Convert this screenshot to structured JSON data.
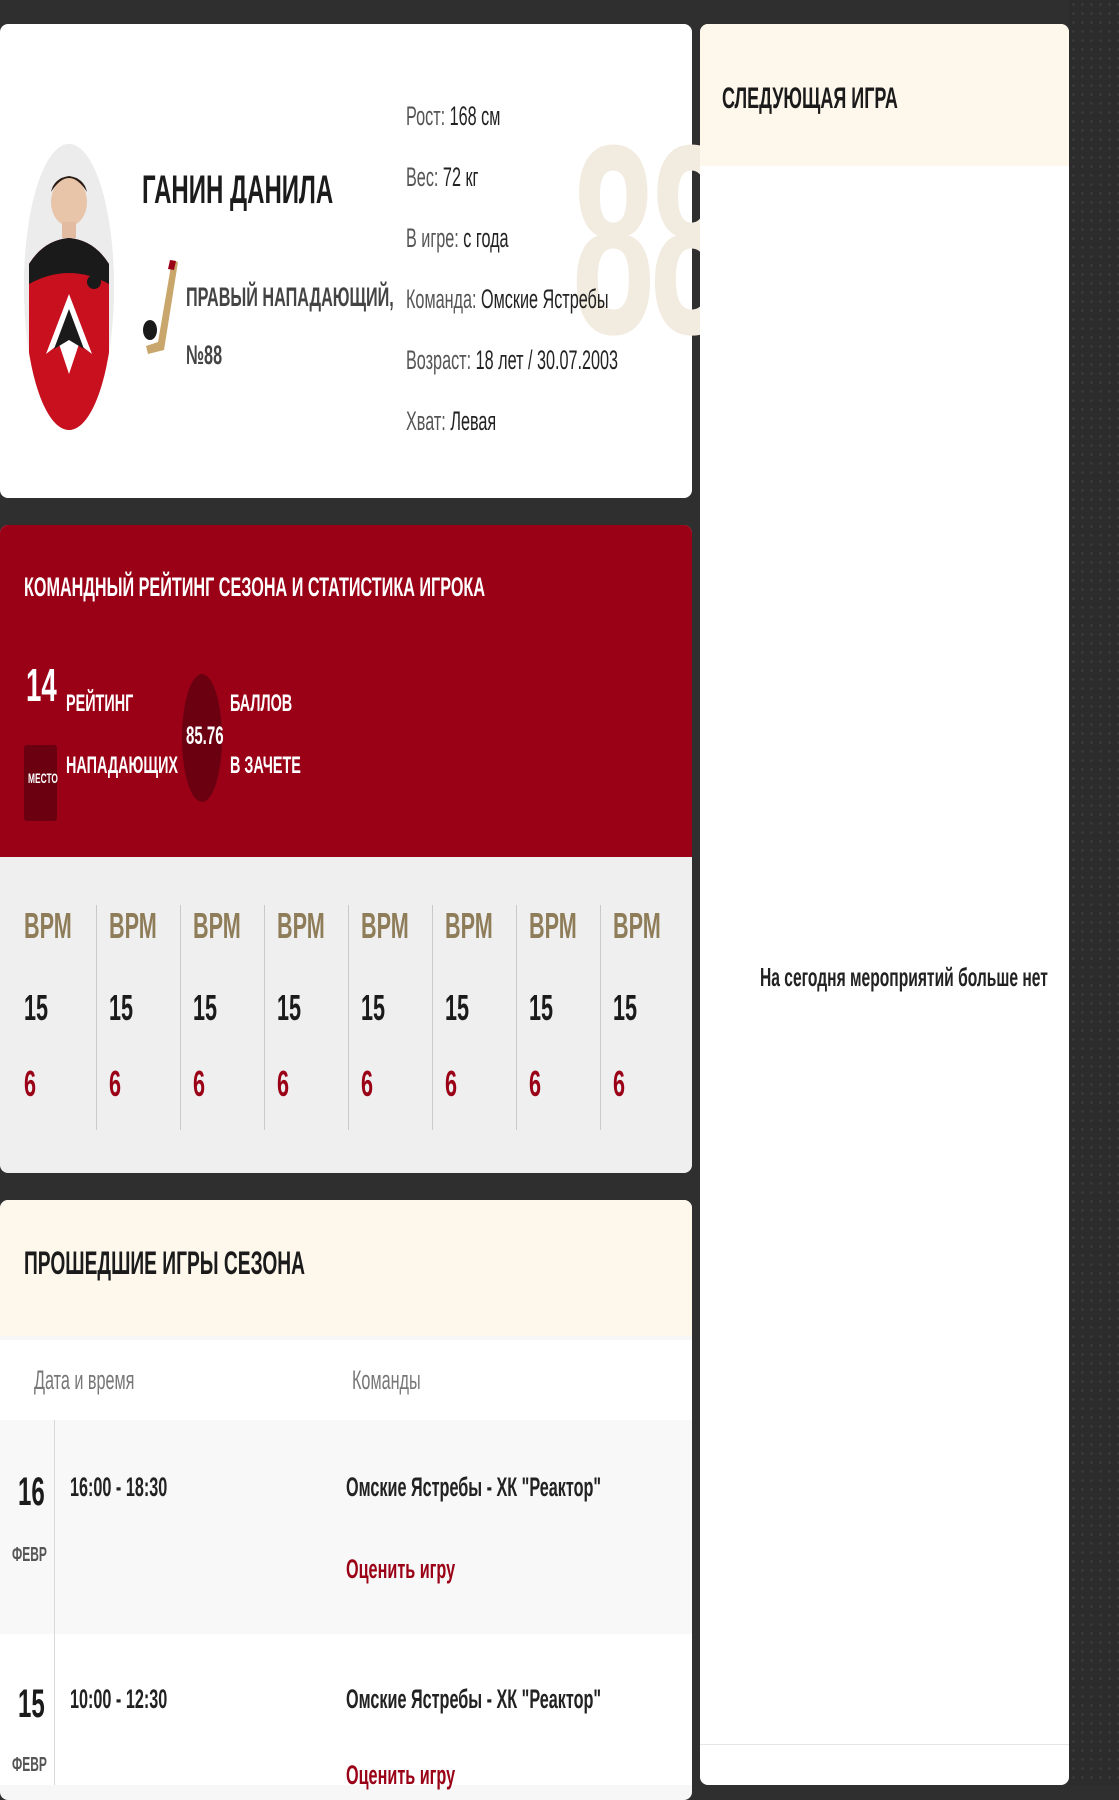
{
  "player": {
    "name": "ГАНИН ДАНИЛА",
    "position_line1": "ПРАВЫЙ НАПАДАЮЩИЙ,",
    "position_line2": "№88",
    "number": "88",
    "info": [
      {
        "label": "Рост:",
        "value": "168 см"
      },
      {
        "label": "Вес:",
        "value": "72 кг"
      },
      {
        "label": "В игре:",
        "value": "с года"
      },
      {
        "label": "Команда:",
        "value": "Омские Ястребы"
      },
      {
        "label": "Возраст:",
        "value": "18 лет / 30.07.2003"
      },
      {
        "label": "Хват:",
        "value": "Левая"
      }
    ]
  },
  "rating": {
    "title": "КОМАНДНЫЙ РЕЙТИНГ СЕЗОНА И СТАТИСТИКА ИГРОКА",
    "place": "14",
    "place_label": "МЕСТО",
    "rating_line1": "РЕЙТИНГ",
    "rating_line2": "НАПАДАЮЩИХ",
    "score": "85.76",
    "score_line1": "БАЛЛОВ",
    "score_line2": "В ЗАЧЕТЕ",
    "stats": [
      {
        "label": "ВРМ",
        "a": "15",
        "b": "6"
      },
      {
        "label": "ВРМ",
        "a": "15",
        "b": "6"
      },
      {
        "label": "ВРМ",
        "a": "15",
        "b": "6"
      },
      {
        "label": "ВРМ",
        "a": "15",
        "b": "6"
      },
      {
        "label": "ВРМ",
        "a": "15",
        "b": "6"
      },
      {
        "label": "ВРМ",
        "a": "15",
        "b": "6"
      },
      {
        "label": "ВРМ",
        "a": "15",
        "b": "6"
      },
      {
        "label": "ВРМ",
        "a": "15",
        "b": "6"
      }
    ]
  },
  "games": {
    "title": "ПРОШЕДШИЕ ИГРЫ СЕЗОНА",
    "col_date": "Дата и время",
    "col_teams": "Команды",
    "rows": [
      {
        "day": "16",
        "month": "ФЕВР",
        "time": "16:00 - 18:30",
        "teams": "Омские Ястребы - ХК \"Реактор\"",
        "action": "Оценить игру"
      },
      {
        "day": "15",
        "month": "ФЕВР",
        "time": "10:00 - 12:30",
        "teams": "Омские Ястребы - ХК \"Реактор\"",
        "action": "Оценить игру"
      }
    ]
  },
  "next_game": {
    "title": "СЛЕДУЮЩАЯ ИГРА",
    "empty_text": "На сегодня мероприятий больше нет"
  },
  "colors": {
    "accent_red": "#9a0116",
    "dark_red": "#6a0010",
    "gold": "#8f7d5a",
    "cream": "#fdf7ec"
  }
}
